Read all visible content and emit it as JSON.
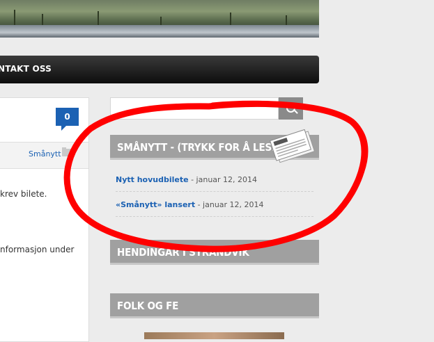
{
  "nav": {
    "item": "NTAKT OSS"
  },
  "article": {
    "comment_count": "0",
    "category": "Smånytt",
    "line1": "krev bilete.",
    "line2": "nformasjon under"
  },
  "search": {
    "placeholder": ""
  },
  "widgets": [
    {
      "title": "SMÅNYTT - (TRYKK FOR Å LESE)"
    },
    {
      "title": "HENDINGAR I STRANDVIK"
    },
    {
      "title": "FOLK OG FE"
    }
  ],
  "posts": [
    {
      "title": "Nytt hovudbilete",
      "date": " - januar 12, 2014"
    },
    {
      "title": "«Smånytt» lansert",
      "date": " - januar 12, 2014"
    }
  ],
  "colors": {
    "accent": "#1b61b3",
    "annotation": "#ff0000",
    "widget_header": "#a0a0a0"
  }
}
